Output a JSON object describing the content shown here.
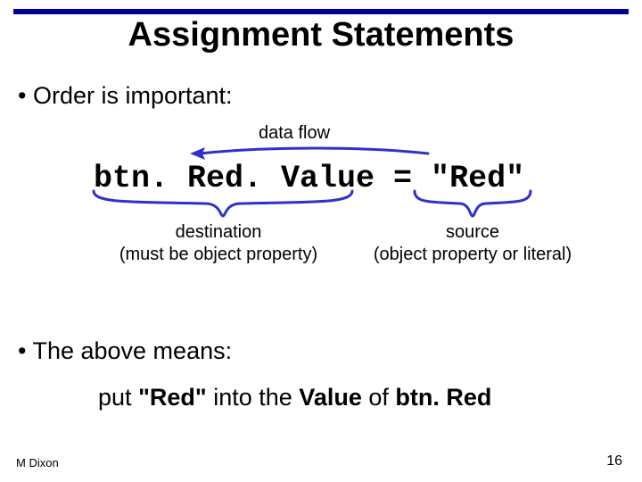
{
  "title": "Assignment Statements",
  "bullets": {
    "order": "Order is important:",
    "means": "The above means:"
  },
  "annotations": {
    "data_flow": "data flow",
    "destination_line1": "destination",
    "destination_line2": "(must be object property)",
    "source_line1": "source",
    "source_line2": "(object property or literal)"
  },
  "code": "btn. Red. Value = \"Red\"",
  "meaning": {
    "w_put": "put",
    "w_red": "\"Red\"",
    "w_into_the": "into the",
    "w_value": "Value",
    "w_of": "of",
    "w_btnred": "btn. Red"
  },
  "footer": {
    "author": "M Dixon",
    "page": "16"
  },
  "colors": {
    "accent": "#000099",
    "ink": "#3030cc"
  }
}
